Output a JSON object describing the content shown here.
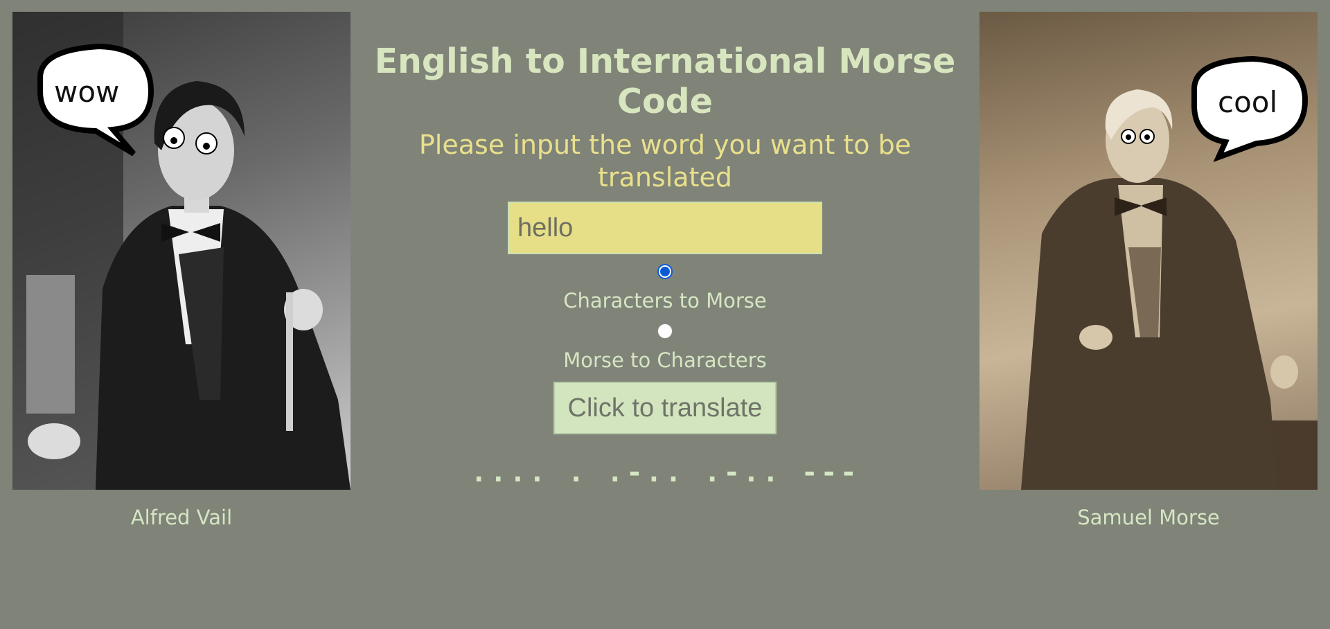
{
  "header": {
    "title": "English to International Morse Code",
    "subtitle": "Please input the word you want to be translated"
  },
  "form": {
    "input_value": "hello",
    "options": [
      {
        "label": "Characters to Morse",
        "checked": true
      },
      {
        "label": "Morse to Characters",
        "checked": false
      }
    ],
    "button_label": "Click to translate"
  },
  "output": {
    "morse": ".... . .-.. .-.. ---"
  },
  "portraits": {
    "left": {
      "caption": "Alfred Vail",
      "bubble": "wow"
    },
    "right": {
      "caption": "Samuel Morse",
      "bubble": "cool"
    }
  }
}
